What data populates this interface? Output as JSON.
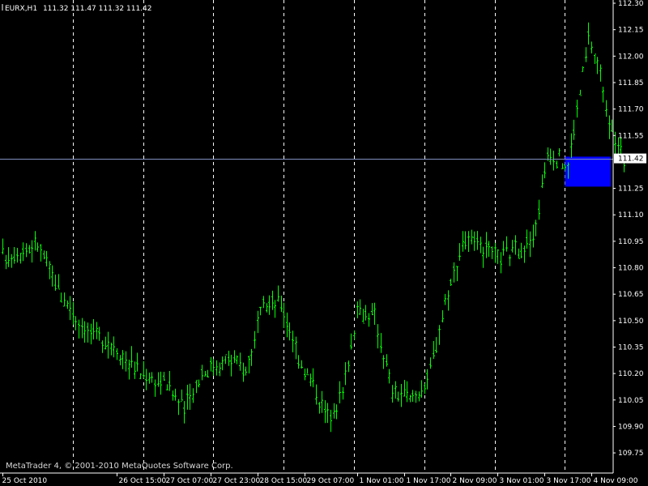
{
  "window": {
    "symbol_title": "EURX,H1",
    "ohlc_text": "111.32 111.47 111.32 111.42",
    "copyright": "MetaTrader 4, © 2001-2010 MetaQuotes Software Corp."
  },
  "colors": {
    "background": "#000000",
    "bars": "#00ff00",
    "grid": "#ffffff",
    "price_line": "#8090c0",
    "highlight": "#0000ff",
    "axis_text": "#ffffff"
  },
  "chart_data": {
    "type": "ohlc",
    "title": "EURX,H1",
    "xlabel": "",
    "ylabel": "",
    "ylim": [
      109.7,
      112.3
    ],
    "y_ticks": [
      112.3,
      112.15,
      112.0,
      111.85,
      111.7,
      111.55,
      111.42,
      111.25,
      111.1,
      110.95,
      110.8,
      110.65,
      110.5,
      110.35,
      110.2,
      110.05,
      109.9,
      109.75
    ],
    "current_price": 111.42,
    "x_tick_labels": [
      "25 Oct 2010",
      "26 Oct 15:00",
      "27 Oct 07:00",
      "27 Oct 23:00",
      "28 Oct 15:00",
      "29 Oct 07:00",
      "1 Nov 01:00",
      "1 Nov 17:00",
      "2 Nov 09:00",
      "3 Nov 01:00",
      "3 Nov 17:00",
      "4 Nov 09:00"
    ],
    "period_separators": [
      "26 Oct 00:00",
      "27 Oct 00:00",
      "28 Oct 00:00",
      "29 Oct 00:00",
      "1 Nov 00:00",
      "2 Nov 00:00",
      "3 Nov 00:00",
      "4 Nov 00:00"
    ],
    "close_path": [
      [
        "25 Oct 2010",
        110.86
      ],
      [
        "25 Oct 12:00",
        110.93
      ],
      [
        "25 Oct 20:00",
        110.64
      ],
      [
        "26 Oct 05:00",
        110.44
      ],
      [
        "26 Oct 14:00",
        110.36
      ],
      [
        "26 Oct 23:00",
        110.2
      ],
      [
        "27 Oct 08:00",
        110.14
      ],
      [
        "27 Oct 14:00",
        110.0
      ],
      [
        "27 Oct 20:00",
        110.21
      ],
      [
        "28 Oct 05:00",
        110.28
      ],
      [
        "28 Oct 11:00",
        110.22
      ],
      [
        "28 Oct 17:00",
        110.58
      ],
      [
        "28 Oct 23:00",
        110.6
      ],
      [
        "29 Oct 05:00",
        110.3
      ],
      [
        "29 Oct 11:00",
        110.1
      ],
      [
        "29 Oct 15:00",
        109.95
      ],
      [
        "29 Oct 20:00",
        110.1
      ],
      [
        "1 Nov 01:00",
        110.55
      ],
      [
        "1 Nov 07:00",
        110.52
      ],
      [
        "1 Nov 13:00",
        110.1
      ],
      [
        "1 Nov 19:00",
        110.05
      ],
      [
        "2 Nov 01:00",
        110.15
      ],
      [
        "2 Nov 07:00",
        110.6
      ],
      [
        "2 Nov 13:00",
        110.95
      ],
      [
        "2 Nov 19:00",
        110.92
      ],
      [
        "3 Nov 01:00",
        110.85
      ],
      [
        "3 Nov 07:00",
        110.9
      ],
      [
        "3 Nov 13:00",
        110.95
      ],
      [
        "3 Nov 18:00",
        111.45
      ],
      [
        "4 Nov 01:00",
        111.38
      ],
      [
        "4 Nov 05:00",
        111.8
      ],
      [
        "4 Nov 08:00",
        112.1
      ],
      [
        "4 Nov 12:00",
        111.9
      ],
      [
        "4 Nov 16:00",
        111.55
      ],
      [
        "4 Nov 20:00",
        111.42
      ]
    ],
    "highlight_zone": {
      "price_low": 111.26,
      "price_high": 111.43,
      "time_start": "4 Nov 00:00",
      "time_end": "4 Nov 23:00"
    }
  }
}
